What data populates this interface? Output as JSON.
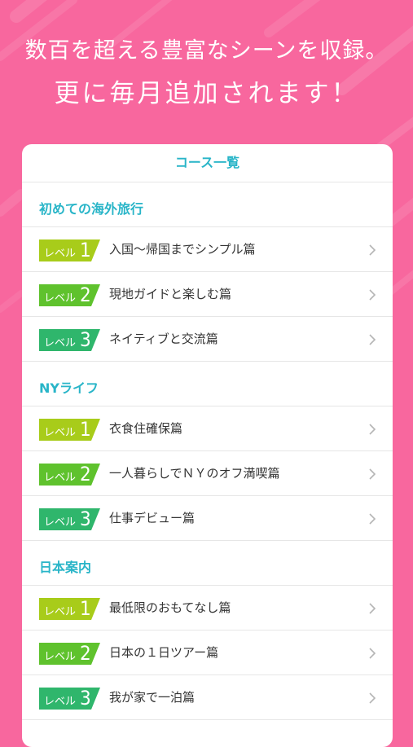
{
  "headline": {
    "line1": "数百を超える豊富なシーンを収録。",
    "line2": "更に毎月追加されます！"
  },
  "card": {
    "title": "コース一覧"
  },
  "level_prefix": "レベル",
  "colors": {
    "background": "#f8679e",
    "accent": "#29b5c8",
    "level1": "#a8cc1a",
    "level2": "#5fc22d",
    "level3": "#2fb66c"
  },
  "sections": [
    {
      "title": "初めての海外旅行",
      "items": [
        {
          "level": "1",
          "label": "入国〜帰国までシンプル篇"
        },
        {
          "level": "2",
          "label": "現地ガイドと楽しむ篇"
        },
        {
          "level": "3",
          "label": "ネイティブと交流篇"
        }
      ]
    },
    {
      "title": "NYライフ",
      "items": [
        {
          "level": "1",
          "label": "衣食住確保篇"
        },
        {
          "level": "2",
          "label": "一人暮らしでＮＹのオフ満喫篇"
        },
        {
          "level": "3",
          "label": "仕事デビュー篇"
        }
      ]
    },
    {
      "title": "日本案内",
      "items": [
        {
          "level": "1",
          "label": "最低限のおもてなし篇"
        },
        {
          "level": "2",
          "label": "日本の１日ツアー篇"
        },
        {
          "level": "3",
          "label": "我が家で一泊篇"
        }
      ]
    }
  ]
}
